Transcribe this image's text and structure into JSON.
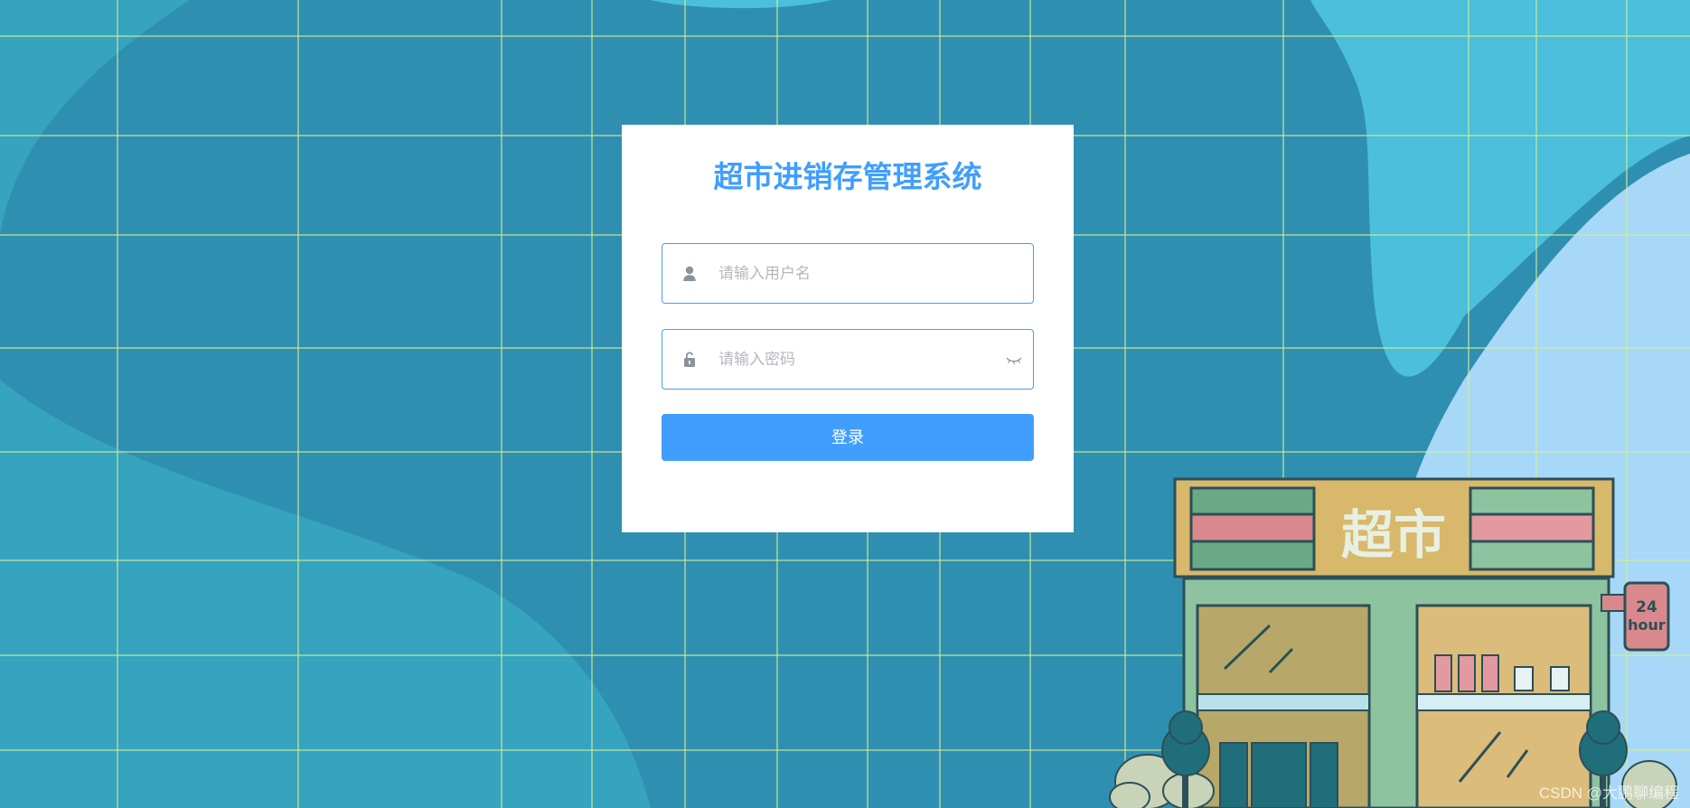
{
  "app": {
    "title": "超市进销存管理系统"
  },
  "form": {
    "username": {
      "placeholder": "请输入用户名",
      "value": "",
      "icon": "user-icon"
    },
    "password": {
      "placeholder": "请输入密码",
      "value": "",
      "icon": "lock-icon",
      "toggle_icon": "eye-closed-icon"
    },
    "login_label": "登录"
  },
  "illustration": {
    "store_sign": "超市",
    "hours_sign_top": "24",
    "hours_sign_bottom": "hour"
  },
  "watermark": "CSDN @大鹏聊编程",
  "colors": {
    "accent": "#409eff",
    "background": "#2f8fb1",
    "card": "#ffffff"
  }
}
